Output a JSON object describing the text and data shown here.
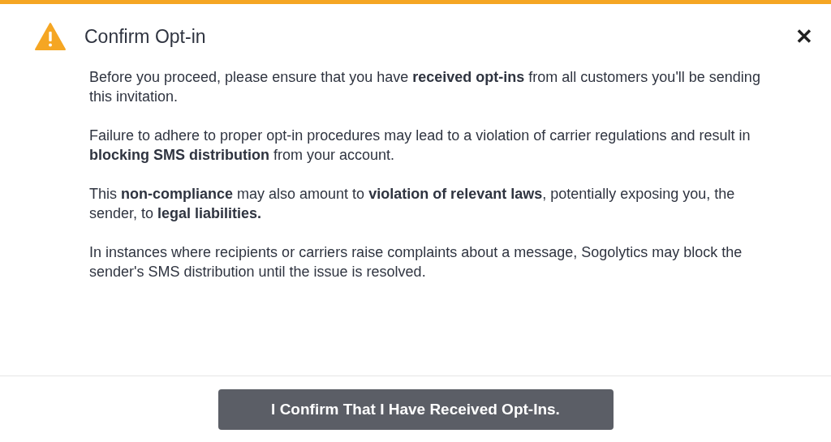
{
  "dialog": {
    "title": "Confirm Opt-in",
    "close": "✕",
    "paragraphs": [
      "Before you proceed, please ensure that you have **received opt-ins** from all customers you'll be sending this invitation.",
      "Failure to adhere to proper opt-in procedures may lead to a violation of carrier regulations and result in **blocking SMS distribution** from your account.",
      "This **non-compliance** may also amount to **violation of relevant laws**, potentially exposing you, the sender, to **legal liabilities.**",
      "In instances where recipients or carriers raise complaints about a message, Sogolytics may block the sender's SMS distribution until the issue is resolved."
    ],
    "confirm_button": "I Confirm That I Have Received Opt-Ins."
  }
}
